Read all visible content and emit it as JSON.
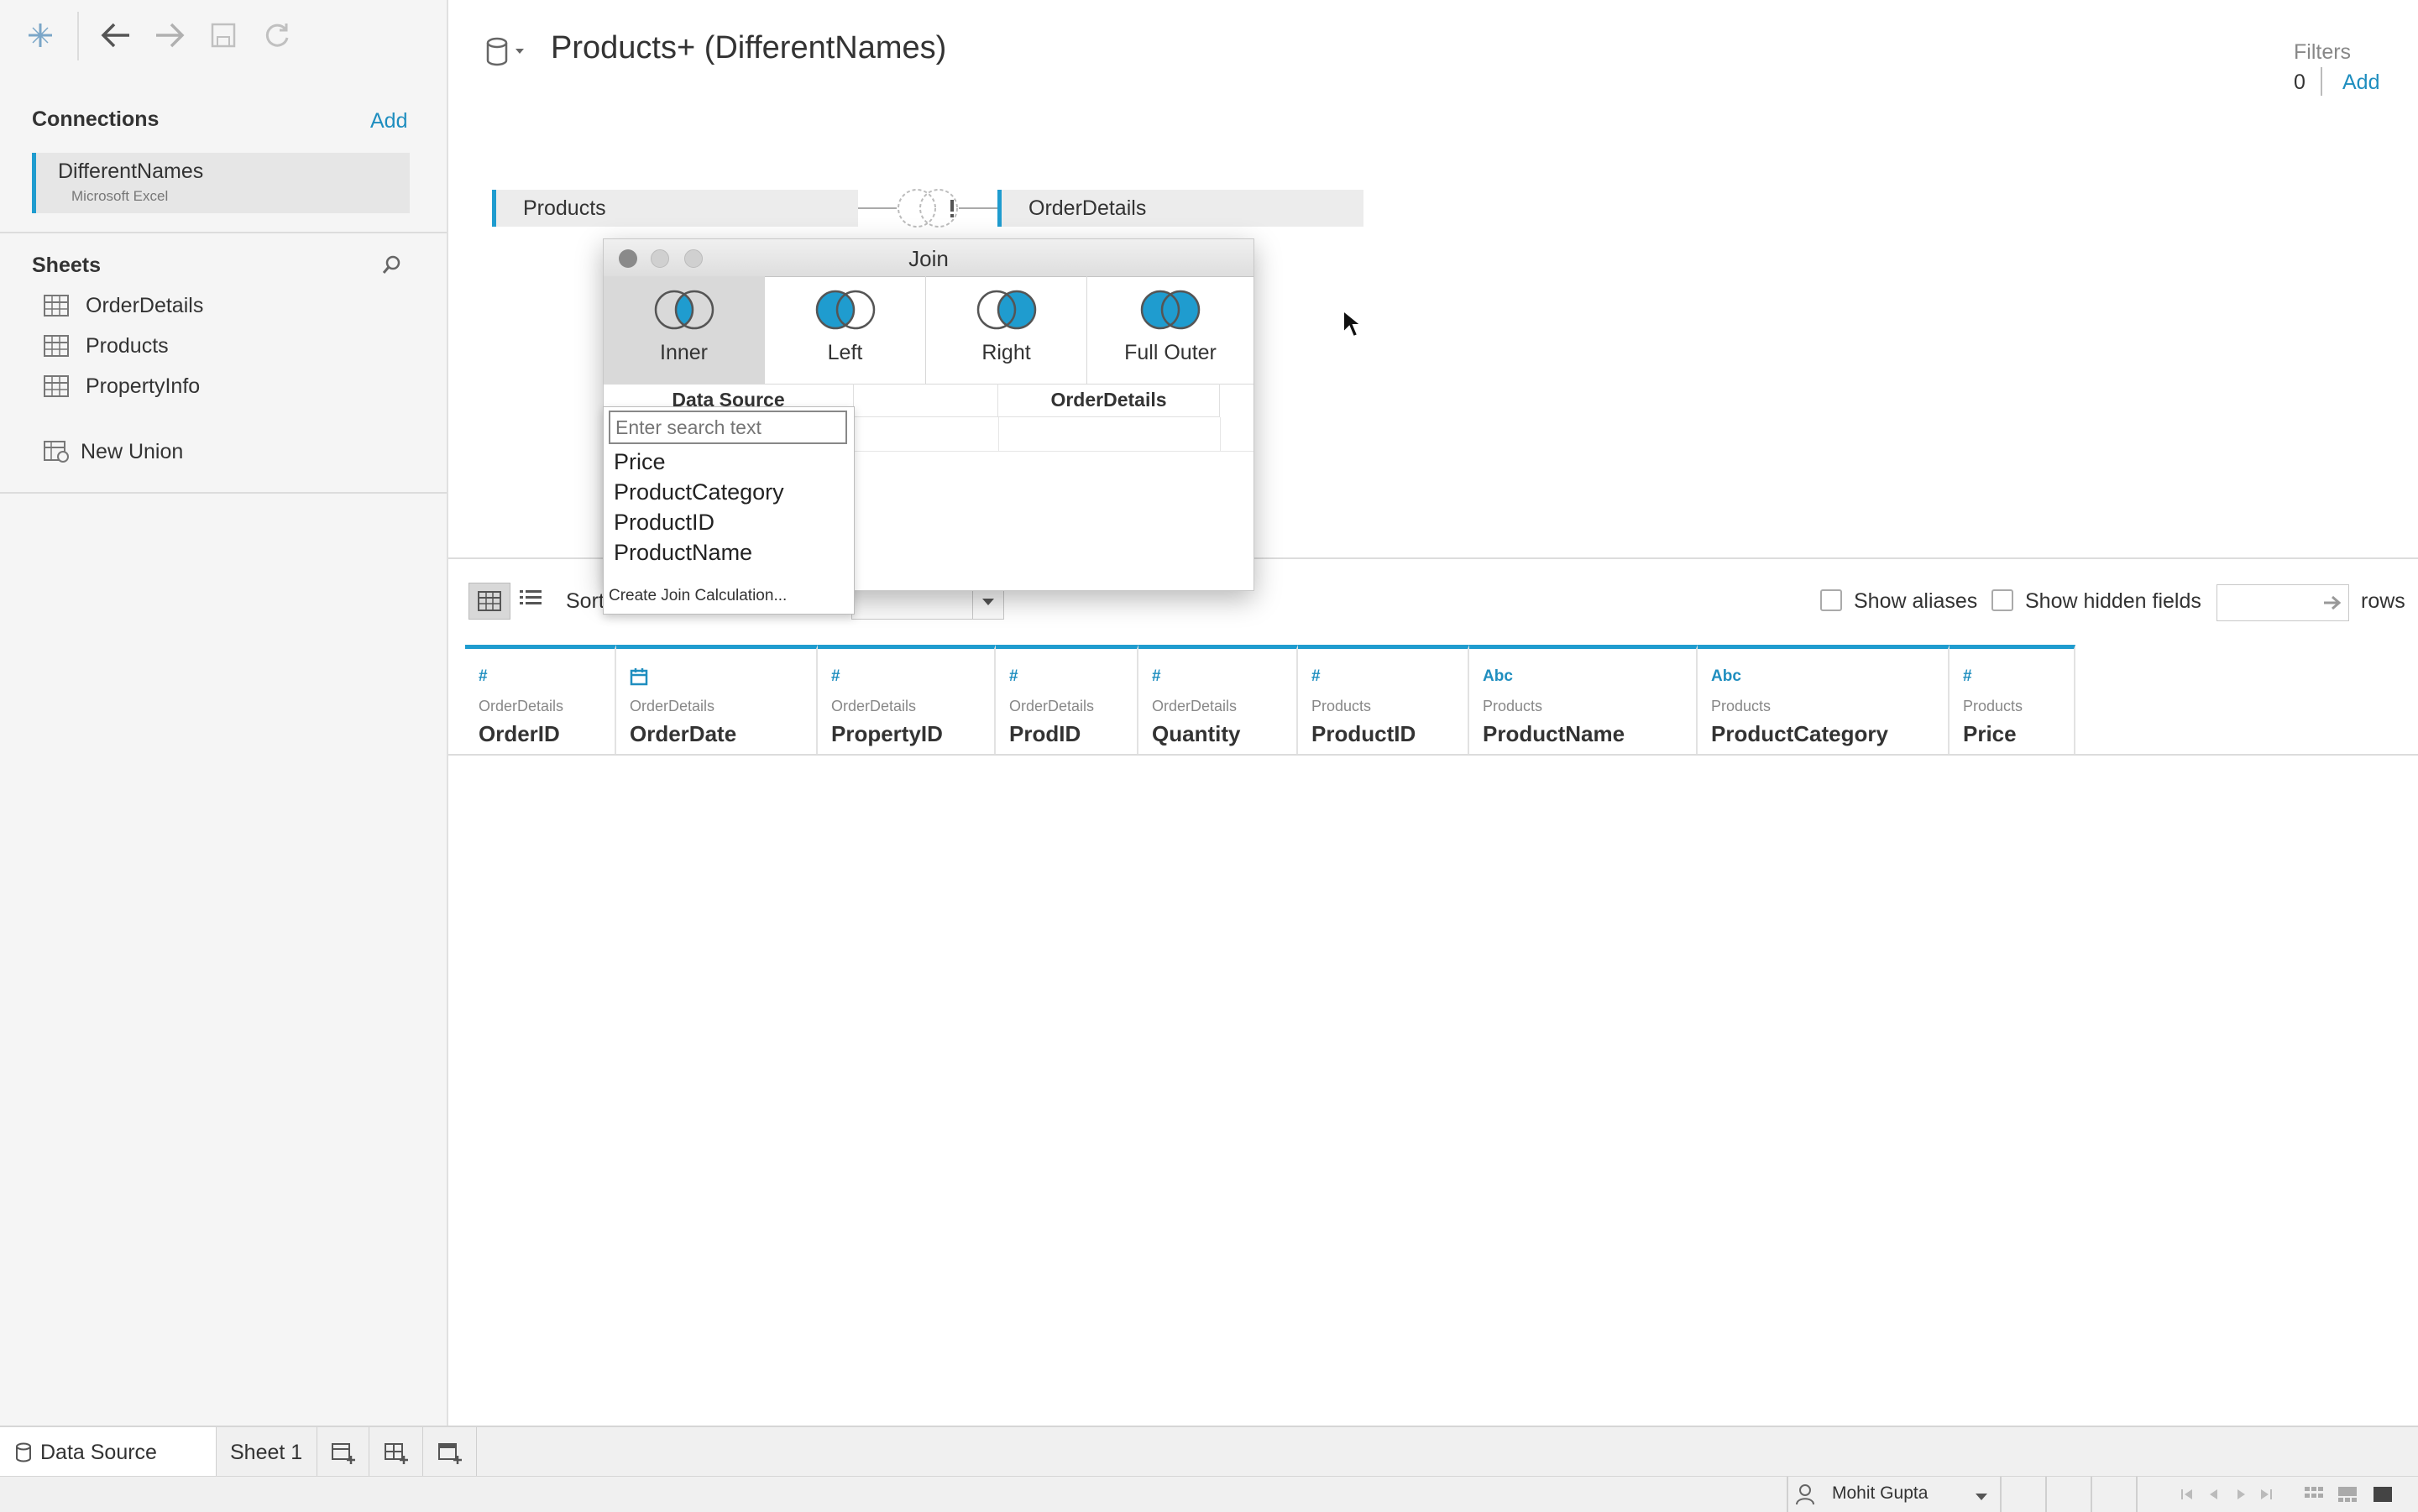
{
  "sidebar": {
    "connections_title": "Connections",
    "connections_add": "Add",
    "connection": {
      "name": "DifferentNames",
      "type": "Microsoft Excel"
    },
    "sheets_title": "Sheets",
    "sheets": [
      {
        "label": "OrderDetails"
      },
      {
        "label": "Products"
      },
      {
        "label": "PropertyInfo"
      }
    ],
    "new_union": "New Union"
  },
  "canvas": {
    "datasource_title": "Products+ (DifferentNames)",
    "filters_label": "Filters",
    "filters_count": "0",
    "filters_add": "Add",
    "left_table": "Products",
    "right_table": "OrderDetails"
  },
  "join_dialog": {
    "title": "Join",
    "types": [
      {
        "label": "Inner",
        "selected": true
      },
      {
        "label": "Left",
        "selected": false
      },
      {
        "label": "Right",
        "selected": false
      },
      {
        "label": "Full Outer",
        "selected": false
      }
    ],
    "col_left": "Data Source",
    "col_right": "OrderDetails",
    "search_placeholder": "Enter search text",
    "fields": [
      "Price",
      "ProductCategory",
      "ProductID",
      "ProductName"
    ],
    "create_calc": "Create Join Calculation..."
  },
  "grid_toolbar": {
    "sort_label": "Sort",
    "show_aliases": "Show aliases",
    "show_hidden": "Show hidden fields",
    "rows_label": "rows"
  },
  "columns": [
    {
      "type": "#",
      "source": "OrderDetails",
      "name": "OrderID"
    },
    {
      "type": "date-icon",
      "source": "OrderDetails",
      "name": "OrderDate"
    },
    {
      "type": "#",
      "source": "OrderDetails",
      "name": "PropertyID"
    },
    {
      "type": "#",
      "source": "OrderDetails",
      "name": "ProdID"
    },
    {
      "type": "#",
      "source": "OrderDetails",
      "name": "Quantity"
    },
    {
      "type": "#",
      "source": "Products",
      "name": "ProductID"
    },
    {
      "type": "Abc",
      "source": "Products",
      "name": "ProductName"
    },
    {
      "type": "Abc",
      "source": "Products",
      "name": "ProductCategory"
    },
    {
      "type": "#",
      "source": "Products",
      "name": "Price"
    }
  ],
  "bottom": {
    "datasource_tab": "Data Source",
    "sheet_tab": "Sheet 1",
    "user": "Mohit Gupta"
  },
  "colors": {
    "accent": "#1f9ccf",
    "link": "#1f8ebf"
  }
}
